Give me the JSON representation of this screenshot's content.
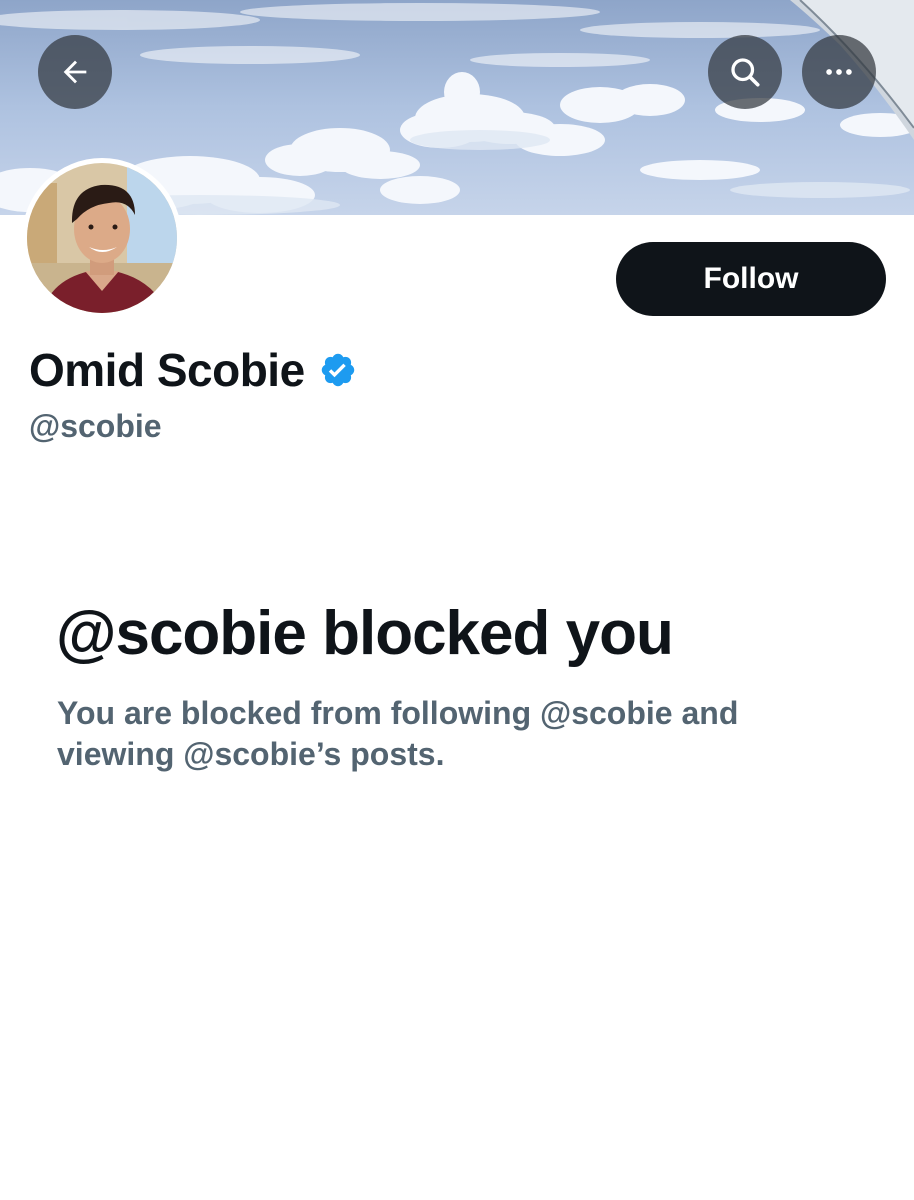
{
  "header": {
    "back_icon": "arrow-left-icon",
    "search_icon": "search-icon",
    "more_icon": "more-horizontal-icon"
  },
  "profile": {
    "display_name": "Omid Scobie",
    "verified": true,
    "verified_color": "#1d9bf0",
    "handle": "@scobie",
    "follow_label": "Follow"
  },
  "blocked": {
    "title": "@scobie blocked you",
    "description": "You are blocked from following @scobie and viewing @scobie’s posts."
  },
  "colors": {
    "primary_text": "#0f1419",
    "secondary_text": "#536471",
    "follow_bg": "#0f1419"
  }
}
